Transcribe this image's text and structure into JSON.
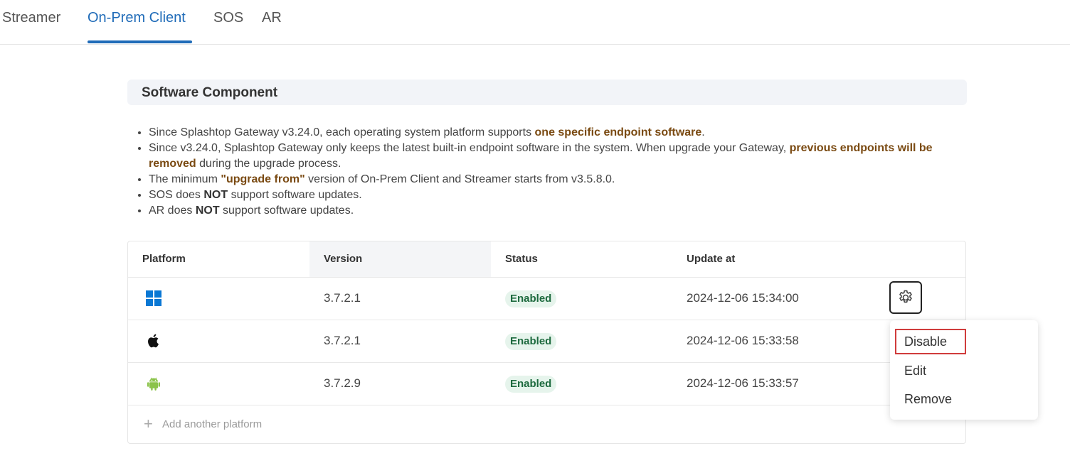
{
  "tabs": [
    {
      "label": "Streamer"
    },
    {
      "label": "On-Prem Client"
    },
    {
      "label": "SOS"
    },
    {
      "label": "AR"
    }
  ],
  "active_tab": "On-Prem Client",
  "section": {
    "title": "Software Component"
  },
  "notes": {
    "n1_a": "Since Splashtop Gateway v3.24.0, each operating system platform supports ",
    "n1_b": "one specific endpoint software",
    "n1_c": ".",
    "n2_a": "Since v3.24.0, Splashtop Gateway only keeps the latest built-in endpoint software in the system. When upgrade your Gateway, ",
    "n2_b": "previous endpoints will be removed",
    "n2_c": " during the upgrade process.",
    "n3_a": "The minimum ",
    "n3_b": "\"upgrade from\"",
    "n3_c": " version of On-Prem Client and Streamer starts from v3.5.8.0.",
    "n4_a": "SOS does ",
    "n4_b": "NOT",
    "n4_c": " support software updates.",
    "n5_a": "AR does ",
    "n5_b": "NOT",
    "n5_c": " support software updates."
  },
  "table": {
    "columns": [
      "Platform",
      "Version",
      "Status",
      "Update at"
    ],
    "rows": [
      {
        "platform_icon": "windows-icon",
        "version": "3.7.2.1",
        "status": "Enabled",
        "updated": "2024-12-06 15:34:00"
      },
      {
        "platform_icon": "apple-icon",
        "version": "3.7.2.1",
        "status": "Enabled",
        "updated": "2024-12-06 15:33:58"
      },
      {
        "platform_icon": "android-icon",
        "version": "3.7.2.9",
        "status": "Enabled",
        "updated": "2024-12-06 15:33:57"
      }
    ],
    "add_label": "Add another platform"
  },
  "menu": {
    "items": [
      "Disable",
      "Edit",
      "Remove"
    ]
  },
  "colors": {
    "accent": "#1f6bb8",
    "highlight_text": "#7a4a12",
    "status_bg": "#e6f4ec",
    "status_text": "#1d6a3e",
    "windows": "#0a78d4",
    "android": "#8bc34a",
    "menu_focus_border": "#d03c3c"
  }
}
